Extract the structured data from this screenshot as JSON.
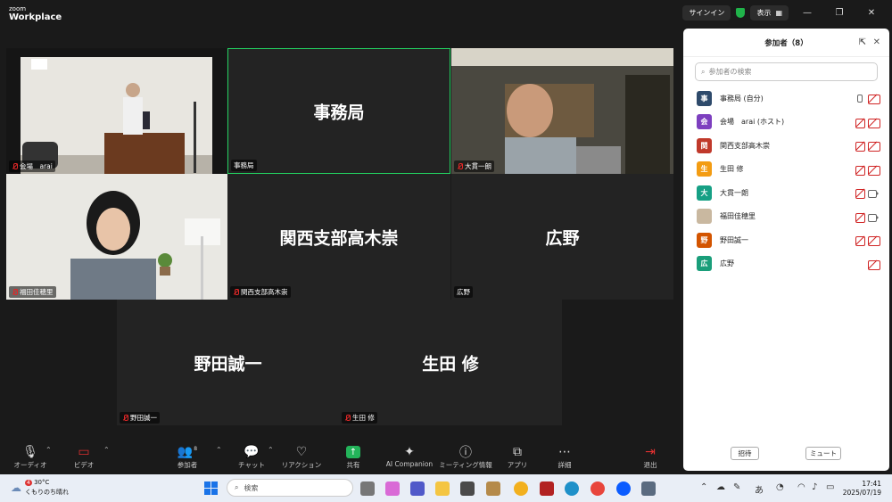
{
  "titlebar": {
    "logo_small": "zoom",
    "logo_big": "Workplace",
    "signin": "サインイン",
    "view": "表示"
  },
  "tiles": {
    "venue": {
      "label": "会場　arai"
    },
    "jimukyoku": {
      "big": "事務局",
      "label": "事務局"
    },
    "onuki": {
      "label": "大貫一朗"
    },
    "fukuda": {
      "label": "福田佳穂里"
    },
    "kansai": {
      "big": "関西支部高木崇",
      "label": "関西支部高木崇"
    },
    "hirono": {
      "big": "広野",
      "label": "広野"
    },
    "noda": {
      "big": "野田誠一",
      "label": "野田誠一"
    },
    "ikuta": {
      "big": "生田 修",
      "label": "生田 修"
    }
  },
  "toolbar": {
    "audio": "オーディオ",
    "video": "ビデオ",
    "participants": "参加者",
    "participants_count": "8",
    "chat": "チャット",
    "reaction": "リアクション",
    "share": "共有",
    "ai": "AI Companion",
    "meeting_info": "ミーティング情報",
    "apps": "アプリ",
    "more": "詳細",
    "leave": "退出"
  },
  "panel": {
    "title": "参加者（8）",
    "search_placeholder": "参加者の検索",
    "participants": [
      {
        "name": "事務局 (自分)",
        "initial": "事",
        "color": "#2e4a6b",
        "mic": "on",
        "cam": "off"
      },
      {
        "name": "会場　arai (ホスト)",
        "initial": "会",
        "color": "#7d3fbf",
        "mic": "off",
        "cam": "off"
      },
      {
        "name": "関西支部高木崇",
        "initial": "関",
        "color": "#c0392b",
        "mic": "off",
        "cam": "off"
      },
      {
        "name": "生田 修",
        "initial": "生",
        "color": "#f39c12",
        "mic": "off",
        "cam": "off"
      },
      {
        "name": "大貫一朗",
        "initial": "大",
        "color": "#16a085",
        "mic": "off",
        "cam": "on"
      },
      {
        "name": "福田佳穂里",
        "initial": "",
        "color": "#c9b8a0",
        "mic": "off",
        "cam": "on"
      },
      {
        "name": "野田誠一",
        "initial": "野",
        "color": "#d35400",
        "mic": "off",
        "cam": "off"
      },
      {
        "name": "広野",
        "initial": "広",
        "color": "#1a9e7a",
        "mic": "",
        "cam": "off"
      }
    ],
    "invite": "招待",
    "mute": "ミュート"
  },
  "taskbar": {
    "notif": "4",
    "temp": "30°C",
    "weather": "くもりのち晴れ",
    "search": "検索",
    "ime": "あ",
    "time": "17:41",
    "date": "2025/07/19"
  }
}
